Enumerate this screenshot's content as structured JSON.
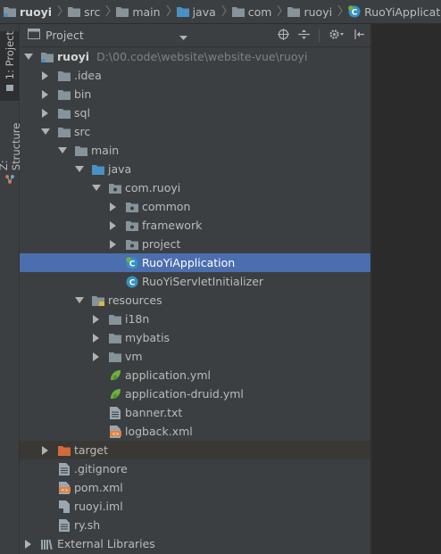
{
  "breadcrumb": [
    {
      "label": "ruoyi",
      "icon": "module-folder-icon"
    },
    {
      "label": "src",
      "icon": "folder-icon"
    },
    {
      "label": "main",
      "icon": "folder-icon"
    },
    {
      "label": "java",
      "icon": "source-folder-icon"
    },
    {
      "label": "com",
      "icon": "folder-icon"
    },
    {
      "label": "ruoyi",
      "icon": "folder-icon"
    },
    {
      "label": "RuoYiApplication",
      "icon": "spring-class-icon"
    }
  ],
  "sidebar": {
    "tabs": [
      {
        "label": "1: Project",
        "active": true
      },
      {
        "label": "Z: Structure",
        "active": false
      }
    ]
  },
  "panel": {
    "title": "Project",
    "tools": [
      "target-icon",
      "collapse-icon",
      "gear-icon",
      "hide-icon"
    ]
  },
  "tree": [
    {
      "label": "ruoyi",
      "path": "D:\\00.code\\website\\website-vue\\ruoyi",
      "depth": 0,
      "expanded": true,
      "icon": "module-folder",
      "bold": true
    },
    {
      "label": ".idea",
      "depth": 1,
      "expanded": false,
      "icon": "folder"
    },
    {
      "label": "bin",
      "depth": 1,
      "expanded": false,
      "icon": "folder"
    },
    {
      "label": "sql",
      "depth": 1,
      "expanded": false,
      "icon": "folder"
    },
    {
      "label": "src",
      "depth": 1,
      "expanded": true,
      "icon": "folder"
    },
    {
      "label": "main",
      "depth": 2,
      "expanded": true,
      "icon": "folder"
    },
    {
      "label": "java",
      "depth": 3,
      "expanded": true,
      "icon": "source-folder"
    },
    {
      "label": "com.ruoyi",
      "depth": 4,
      "expanded": true,
      "icon": "package"
    },
    {
      "label": "common",
      "depth": 5,
      "expanded": false,
      "icon": "package"
    },
    {
      "label": "framework",
      "depth": 5,
      "expanded": false,
      "icon": "package"
    },
    {
      "label": "project",
      "depth": 5,
      "expanded": false,
      "icon": "package"
    },
    {
      "label": "RuoYiApplication",
      "depth": 5,
      "icon": "spring-class",
      "selected": true
    },
    {
      "label": "RuoYiServletInitializer",
      "depth": 5,
      "icon": "class"
    },
    {
      "label": "resources",
      "depth": 3,
      "expanded": true,
      "icon": "resources-folder"
    },
    {
      "label": "i18n",
      "depth": 4,
      "expanded": false,
      "icon": "folder"
    },
    {
      "label": "mybatis",
      "depth": 4,
      "expanded": false,
      "icon": "folder"
    },
    {
      "label": "vm",
      "depth": 4,
      "expanded": false,
      "icon": "folder"
    },
    {
      "label": "application.yml",
      "depth": 4,
      "icon": "spring-yml"
    },
    {
      "label": "application-druid.yml",
      "depth": 4,
      "icon": "spring-yml"
    },
    {
      "label": "banner.txt",
      "depth": 4,
      "icon": "text-file"
    },
    {
      "label": "logback.xml",
      "depth": 4,
      "icon": "xml-file"
    },
    {
      "label": "target",
      "depth": 1,
      "expanded": false,
      "icon": "excluded-folder",
      "excluded": true
    },
    {
      "label": ".gitignore",
      "depth": 1,
      "icon": "text-file"
    },
    {
      "label": "pom.xml",
      "depth": 1,
      "icon": "xml-file"
    },
    {
      "label": "ruoyi.iml",
      "depth": 1,
      "icon": "iml-file"
    },
    {
      "label": "ry.sh",
      "depth": 1,
      "icon": "text-file"
    },
    {
      "label": "External Libraries",
      "depth": 0,
      "expanded": false,
      "icon": "libraries"
    }
  ],
  "colors": {
    "selection": "#4b6eaf",
    "folder": "#87939a",
    "source_folder": "#4a90c5",
    "excluded": "#d36a3b",
    "spring": "#6db33f",
    "class": "#3592c4"
  }
}
